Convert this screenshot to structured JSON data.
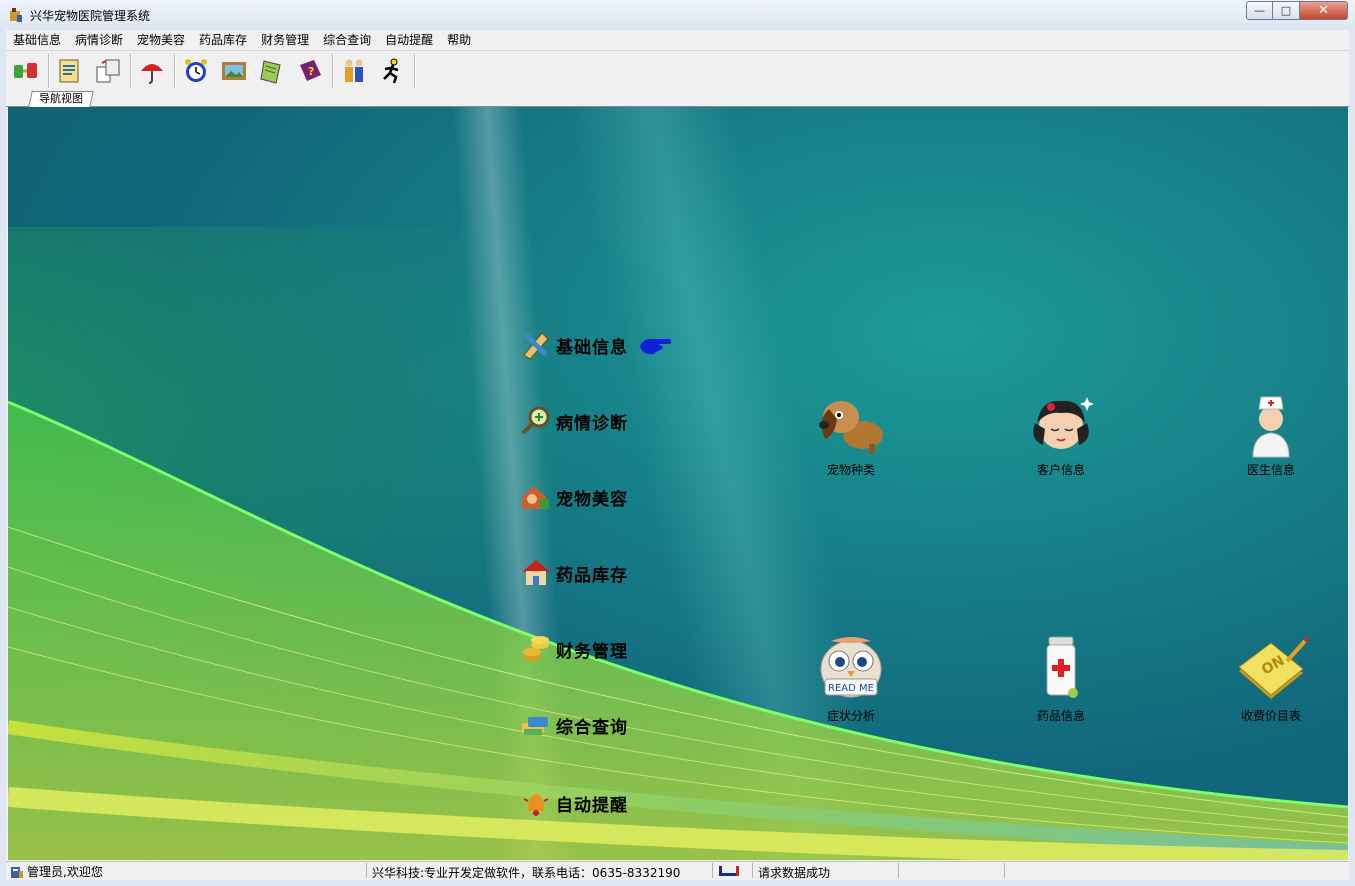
{
  "window": {
    "title": "兴华宠物医院管理系统",
    "minimize_label": "—",
    "maximize_label": "□",
    "close_label": "✕"
  },
  "menu": [
    "基础信息",
    "病情诊断",
    "宠物美容",
    "药品库存",
    "财务管理",
    "综合查询",
    "自动提醒",
    "帮助"
  ],
  "toolbar": {
    "icons": [
      "connect-icon",
      "document-icon",
      "transfer-icon",
      "umbrella-icon",
      "alarm-clock-icon",
      "picture-icon",
      "notebook-icon",
      "help-book-icon",
      "people-icon",
      "runner-icon"
    ]
  },
  "tab": {
    "label": "导航视图"
  },
  "nav": [
    {
      "label": "基础信息",
      "icon": "pencil-ruler-icon"
    },
    {
      "label": "病情诊断",
      "icon": "magnifier-icon"
    },
    {
      "label": "宠物美容",
      "icon": "house-person-icon"
    },
    {
      "label": "药品库存",
      "icon": "house-icon"
    },
    {
      "label": "财务管理",
      "icon": "coins-icon"
    },
    {
      "label": "综合查询",
      "icon": "database-icon"
    },
    {
      "label": "自动提醒",
      "icon": "bell-icon"
    }
  ],
  "tiles": [
    {
      "label": "宠物种类",
      "icon": "dog-icon"
    },
    {
      "label": "客户信息",
      "icon": "girl-face-icon"
    },
    {
      "label": "医生信息",
      "icon": "nurse-icon"
    },
    {
      "label": "症状分析",
      "icon": "owl-read-me-icon"
    },
    {
      "label": "药品信息",
      "icon": "medicine-bottle-icon"
    },
    {
      "label": "收费价目表",
      "icon": "notepad-on-icon"
    }
  ],
  "owl_sign_text": "READ ME",
  "notepad_text": "ON",
  "status": {
    "user": "管理员,欢迎您",
    "company": "兴华科技:专业开发定做软件，联系电话：0635-8332190",
    "message": "请求数据成功"
  },
  "colors": {
    "desktop_teal": "#167c86",
    "pointer_blue": "#1020d8"
  }
}
